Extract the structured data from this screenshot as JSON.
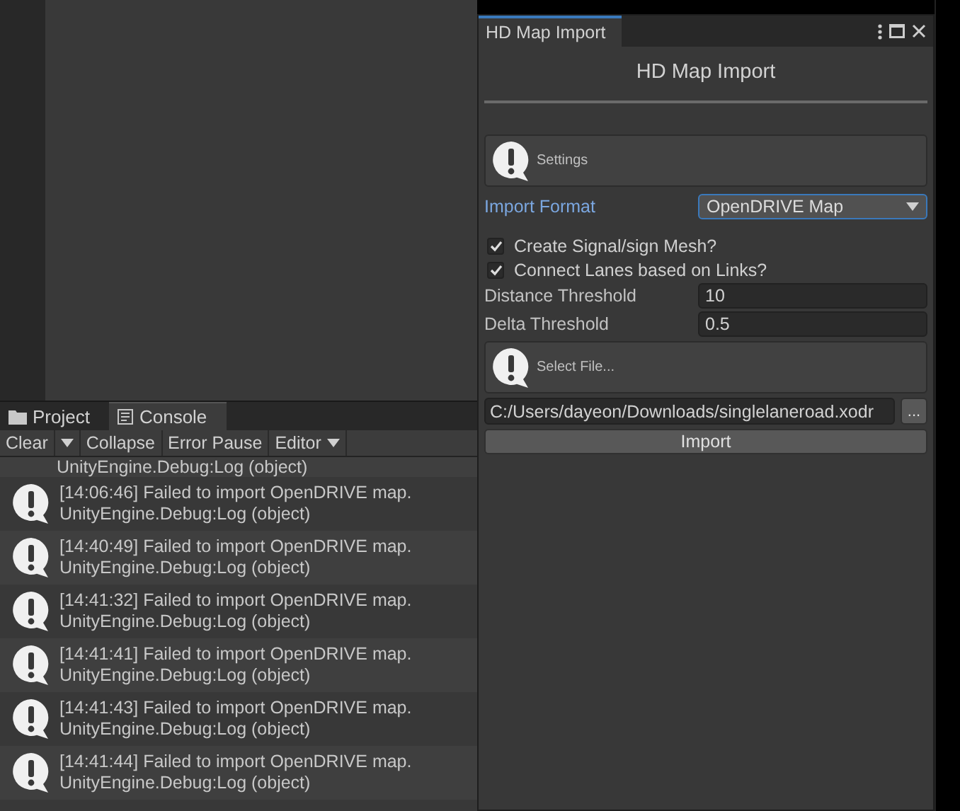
{
  "console": {
    "tabs": [
      {
        "label": "Project",
        "kind": "folder",
        "selected": false
      },
      {
        "label": "Console",
        "kind": "console",
        "selected": true
      }
    ],
    "toolbar": [
      {
        "label": "Clear",
        "kind": "split"
      },
      {
        "label": "Collapse",
        "kind": "button"
      },
      {
        "label": "Error Pause",
        "kind": "button"
      },
      {
        "label": "Editor",
        "kind": "dropdown"
      }
    ],
    "partial_entry": "UnityEngine.Debug:Log (object)",
    "entries": [
      {
        "message": "[14:06:46] Failed to import OpenDRIVE map.",
        "source": "UnityEngine.Debug:Log (object)"
      },
      {
        "message": "[14:40:49] Failed to import OpenDRIVE map.",
        "source": "UnityEngine.Debug:Log (object)"
      },
      {
        "message": "[14:41:32] Failed to import OpenDRIVE map.",
        "source": "UnityEngine.Debug:Log (object)"
      },
      {
        "message": "[14:41:41] Failed to import OpenDRIVE map.",
        "source": "UnityEngine.Debug:Log (object)"
      },
      {
        "message": "[14:41:43] Failed to import OpenDRIVE map.",
        "source": "UnityEngine.Debug:Log (object)"
      },
      {
        "message": "[14:41:44] Failed to import OpenDRIVE map.",
        "source": "UnityEngine.Debug:Log (object)"
      }
    ]
  },
  "window": {
    "tab": "HD Map Import",
    "title": "HD Map Import",
    "settings_note": "Settings",
    "import_format": {
      "label": "Import Format",
      "value": "OpenDRIVE Map"
    },
    "options": [
      {
        "label": "Create Signal/sign Mesh?",
        "checked": true
      },
      {
        "label": "Connect Lanes based on Links?",
        "checked": true
      }
    ],
    "fields": [
      {
        "label": "Distance Threshold",
        "value": "10"
      },
      {
        "label": "Delta Threshold",
        "value": "0.5"
      }
    ],
    "file_note": "Select File...",
    "file_path": "C:/Users/dayeon/Downloads/singlelaneroad.xodr",
    "browse": "...",
    "import_button": "Import"
  }
}
